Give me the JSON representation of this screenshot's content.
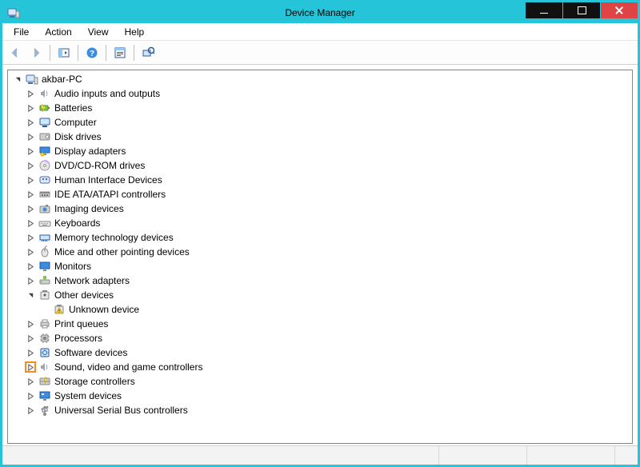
{
  "window": {
    "title": "Device Manager"
  },
  "menu": {
    "items": [
      "File",
      "Action",
      "View",
      "Help"
    ]
  },
  "tree": {
    "root": {
      "label": "akbar-PC",
      "expanded": true,
      "icon": "computer-root"
    },
    "categories": [
      {
        "label": "Audio inputs and outputs",
        "icon": "speaker",
        "expanded": false
      },
      {
        "label": "Batteries",
        "icon": "battery",
        "expanded": false
      },
      {
        "label": "Computer",
        "icon": "computer",
        "expanded": false
      },
      {
        "label": "Disk drives",
        "icon": "disk",
        "expanded": false
      },
      {
        "label": "Display adapters",
        "icon": "display",
        "expanded": false
      },
      {
        "label": "DVD/CD-ROM drives",
        "icon": "cdrom",
        "expanded": false
      },
      {
        "label": "Human Interface Devices",
        "icon": "hid",
        "expanded": false
      },
      {
        "label": "IDE ATA/ATAPI controllers",
        "icon": "ide",
        "expanded": false
      },
      {
        "label": "Imaging devices",
        "icon": "camera",
        "expanded": false
      },
      {
        "label": "Keyboards",
        "icon": "keyboard",
        "expanded": false
      },
      {
        "label": "Memory technology devices",
        "icon": "memory",
        "expanded": false
      },
      {
        "label": "Mice and other pointing devices",
        "icon": "mouse",
        "expanded": false
      },
      {
        "label": "Monitors",
        "icon": "monitor",
        "expanded": false
      },
      {
        "label": "Network adapters",
        "icon": "network",
        "expanded": false
      },
      {
        "label": "Other devices",
        "icon": "other",
        "expanded": true,
        "children": [
          {
            "label": "Unknown device",
            "icon": "warning"
          }
        ]
      },
      {
        "label": "Print queues",
        "icon": "printer",
        "expanded": false
      },
      {
        "label": "Processors",
        "icon": "cpu",
        "expanded": false
      },
      {
        "label": "Software devices",
        "icon": "software",
        "expanded": false
      },
      {
        "label": "Sound, video and game controllers",
        "icon": "speaker",
        "expanded": false,
        "highlighted": true
      },
      {
        "label": "Storage controllers",
        "icon": "storage",
        "expanded": false
      },
      {
        "label": "System devices",
        "icon": "system",
        "expanded": false
      },
      {
        "label": "Universal Serial Bus controllers",
        "icon": "usb",
        "expanded": false
      }
    ]
  }
}
